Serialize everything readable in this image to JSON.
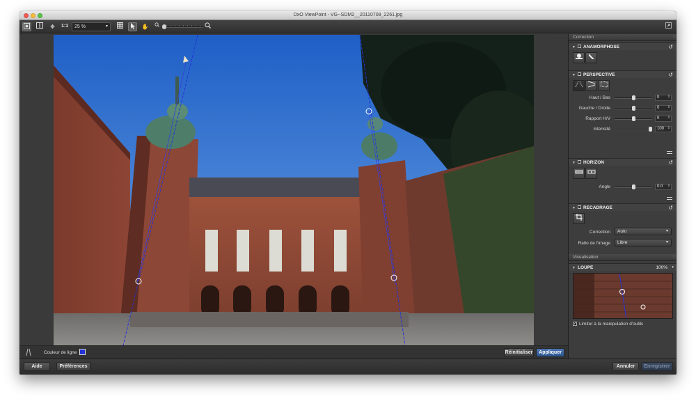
{
  "window": {
    "title": "DxO ViewPoint - VG--SDM2__20110708_2261.jpg"
  },
  "toolbar": {
    "ratio_label": "1:1",
    "zoom_value": "25 %"
  },
  "panel": {
    "correction_header": "Correction",
    "anamorphose": {
      "title": "ANAMORPHOSE"
    },
    "perspective": {
      "title": "PERSPECTIVE",
      "rows": [
        {
          "label": "Haut / Bas",
          "value": "0",
          "level": 0.5
        },
        {
          "label": "Gauche / Droite",
          "value": "0",
          "level": 0.5
        },
        {
          "label": "Rapport H/V",
          "value": "0",
          "level": 0.5
        },
        {
          "label": "Intensité",
          "value": "100",
          "level": 1.0
        }
      ]
    },
    "horizon": {
      "title": "HORIZON",
      "angle_label": "Angle",
      "angle_value": "0.0",
      "angle_level": 0.5
    },
    "recadrage": {
      "title": "RECADRAGE",
      "correction_label": "Correction",
      "correction_value": "Auto",
      "ratio_label": "Ratio de l'image",
      "ratio_value": "Libre"
    },
    "visualisation_header": "Visualisation",
    "loupe": {
      "title": "LOUPE",
      "zoom": "100%",
      "limit_label": "Limiter à la manipulation d'outils"
    }
  },
  "image_footer": {
    "line_color_label": "Couleur de ligne",
    "line_color": "#2433d8",
    "reset_label": "Réinitialiser",
    "apply_label": "Appliquer"
  },
  "bottom_bar": {
    "help_label": "Aide",
    "prefs_label": "Préférences",
    "cancel_label": "Annuler",
    "save_label": "Enregistrer"
  }
}
